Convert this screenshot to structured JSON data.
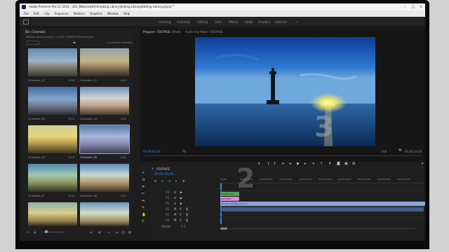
{
  "app": {
    "title": "Adobe Premiere Pro CC 2015 - \\\\01_Materials\\Filmmaking Library\\Editing Library\\Editing Library.prproj *"
  },
  "menu": [
    "File",
    "Edit",
    "Clip",
    "Sequence",
    "Markers",
    "Graphics",
    "Window",
    "Help"
  ],
  "workspaces": [
    "Learning",
    "Assembly",
    "Editing",
    "Color",
    "Effects",
    "Audio",
    "Graphics",
    "Libraries"
  ],
  "project": {
    "tab_label": "Bin: Cinematic",
    "path": "Editing Library.prproj\\2. COLOR CORRECTION\\Cinematic",
    "selection": "1 of 8 items selected",
    "items": [
      {
        "name": "Cinematic_01",
        "duration": "0:24"
      },
      {
        "name": "Cinematic_02",
        "duration": "0:24"
      },
      {
        "name": "Cinematic_03",
        "duration": "0:24"
      },
      {
        "name": "Cinematic_04",
        "duration": "0:24"
      },
      {
        "name": "Cinematic_05",
        "duration": "0:24"
      },
      {
        "name": "Cinematic_06",
        "duration": "0:24"
      },
      {
        "name": "Cinematic_07",
        "duration": "0:24"
      },
      {
        "name": "Cinematic_08",
        "duration": "0:24"
      }
    ]
  },
  "program": {
    "tab_program": "Program: FOOTAGE",
    "tab_effects": "Effects",
    "tab_audio": "Audio Clip Mixer: FOOTAGE",
    "timecode_in": "00;00;00;00",
    "fit": "Fit",
    "quality": "Full",
    "timecode_out": "00;00;24;04",
    "overlay_number": "3"
  },
  "timeline": {
    "tab_label": "FOOTAGE",
    "timecode": "00;00;00;00",
    "ruler": [
      "00;00",
      "00;00;04;00",
      "00;00;08;00",
      "00;00;12;00",
      "00;00;16;00",
      "00;00;20;00",
      "00;00;24;00",
      "00;00;28;00",
      "00;00;32;00",
      "00;00;36;00"
    ],
    "tracks": [
      "V3",
      "V2",
      "V1",
      "A1",
      "A2",
      "A3",
      "Master"
    ],
    "master_value": "0.0",
    "clips": [
      "Adjustment",
      "Cinematic",
      "Render_footage.mp4 [V]"
    ],
    "overlay_number": "2"
  },
  "colors": {
    "accent_blue": "#2d8ceb",
    "clip_green": "#4fa55c",
    "clip_pink": "#d98ad1",
    "clip_blue": "#8aa8e0"
  }
}
